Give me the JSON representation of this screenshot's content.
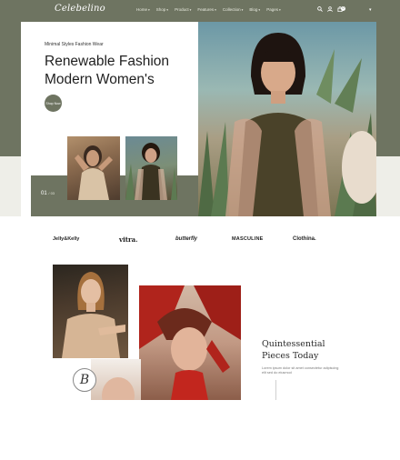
{
  "header": {
    "logo": "Celebelino",
    "nav": [
      {
        "label": "Home"
      },
      {
        "label": "Shop"
      },
      {
        "label": "Product"
      },
      {
        "label": "Features"
      },
      {
        "label": "Collection"
      },
      {
        "label": "Blog"
      },
      {
        "label": "Pages"
      }
    ],
    "icons": [
      "search-icon",
      "user-icon",
      "cart-icon"
    ],
    "cart_count": "0",
    "colors": {
      "brand": "#6e7461"
    }
  },
  "hero": {
    "subtitle": "Minimal Styles Fashion Wear",
    "title_line1": "Renewable Fashion",
    "title_line2": "Modern Women's",
    "button_label": "Shop Now",
    "slide_current": "01",
    "slide_total": "/ 03"
  },
  "brands": [
    "Jelly&Kelly",
    "vitra.",
    "butterfly",
    "MASCULINE",
    "Clothina."
  ],
  "section": {
    "title_line1": "Quintessential",
    "title_line2": "Pieces Today",
    "text": "Lorem ipsum dolor sit amet consectetur adipiscing elit sed do eiusmod",
    "stamp": "B"
  }
}
